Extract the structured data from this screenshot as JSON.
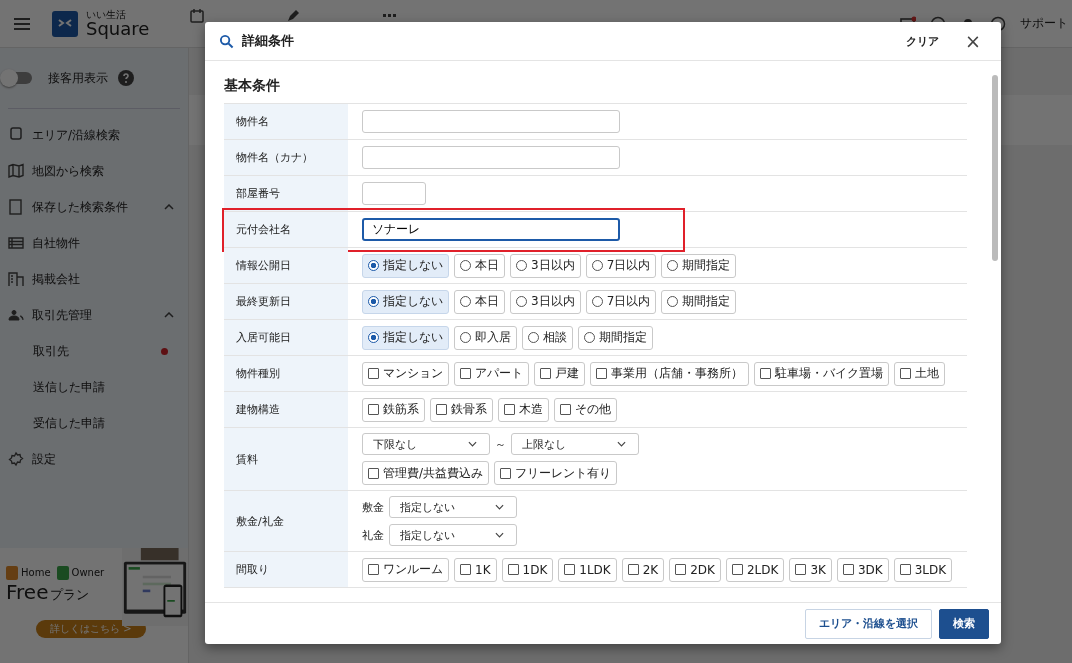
{
  "topbar": {
    "brand_small": "いい生活",
    "brand": "Square",
    "support": "サポート"
  },
  "sidebar": {
    "toggle": {
      "label": "接客用表示",
      "on": false
    },
    "items": [
      {
        "label": "エリア/沿線検索"
      },
      {
        "label": "地図から検索"
      },
      {
        "label": "保存した検索条件",
        "expanded": true
      },
      {
        "label": "自社物件"
      },
      {
        "label": "掲載会社"
      },
      {
        "label": "取引先管理",
        "expanded": true,
        "children": [
          {
            "label": "取引先",
            "notice": true
          },
          {
            "label": "送信した申請",
            "notice": false
          },
          {
            "label": "受信した申請",
            "notice": false
          }
        ]
      },
      {
        "label": "設定"
      }
    ],
    "banner": {
      "home": "Home",
      "owner": "Owner",
      "title_en": "Free",
      "title_ja": "プラン",
      "cta": "詳しくはこちら >"
    }
  },
  "modal": {
    "title": "詳細条件",
    "clear": "クリア",
    "close": "×",
    "section": "基本条件",
    "rows": [
      {
        "label": "物件名",
        "kind": "text",
        "value": "",
        "focused": false,
        "highlighted": false
      },
      {
        "label": "物件名（カナ）",
        "kind": "text",
        "value": "",
        "focused": false,
        "highlighted": false
      },
      {
        "label": "部屋番号",
        "kind": "short_text",
        "value": "",
        "focused": false,
        "highlighted": false
      },
      {
        "label": "元付会社名",
        "kind": "text",
        "value": "ソナーレ",
        "focused": true,
        "highlighted": true
      },
      {
        "label": "情報公開日",
        "kind": "radio",
        "options": [
          {
            "label": "指定しない",
            "selected": true
          },
          {
            "label": "本日",
            "selected": false
          },
          {
            "label": "3日以内",
            "selected": false
          },
          {
            "label": "7日以内",
            "selected": false
          },
          {
            "label": "期間指定",
            "selected": false
          }
        ]
      },
      {
        "label": "最終更新日",
        "kind": "radio",
        "options": [
          {
            "label": "指定しない",
            "selected": true
          },
          {
            "label": "本日",
            "selected": false
          },
          {
            "label": "3日以内",
            "selected": false
          },
          {
            "label": "7日以内",
            "selected": false
          },
          {
            "label": "期間指定",
            "selected": false
          }
        ]
      },
      {
        "label": "入居可能日",
        "kind": "radio",
        "options": [
          {
            "label": "指定しない",
            "selected": true
          },
          {
            "label": "即入居",
            "selected": false
          },
          {
            "label": "相談",
            "selected": false
          },
          {
            "label": "期間指定",
            "selected": false
          }
        ]
      },
      {
        "label": "物件種別",
        "kind": "check",
        "options": [
          {
            "label": "マンション",
            "checked": false
          },
          {
            "label": "アパート",
            "checked": false
          },
          {
            "label": "戸建",
            "checked": false
          },
          {
            "label": "事業用（店舗・事務所）",
            "checked": false
          },
          {
            "label": "駐車場・バイク置場",
            "checked": false
          },
          {
            "label": "土地",
            "checked": false
          }
        ]
      },
      {
        "label": "建物構造",
        "kind": "check",
        "options": [
          {
            "label": "鉄筋系",
            "checked": false
          },
          {
            "label": "鉄骨系",
            "checked": false
          },
          {
            "label": "木造",
            "checked": false
          },
          {
            "label": "その他",
            "checked": false
          }
        ]
      },
      {
        "label": "賃料",
        "kind": "range",
        "selects": [
          {
            "value": "下限なし"
          },
          {
            "value": "上限なし"
          }
        ],
        "separator": "～",
        "options": [
          {
            "label": "管理費/共益費込み",
            "checked": false
          },
          {
            "label": "フリーレント有り",
            "checked": false
          }
        ]
      },
      {
        "label": "敷金/礼金",
        "kind": "pairs",
        "selects": [
          {
            "label": "敷金",
            "value": "指定しない"
          },
          {
            "label": "礼金",
            "value": "指定しない"
          }
        ]
      },
      {
        "label": "間取り",
        "kind": "check",
        "options": [
          {
            "label": "ワンルーム",
            "checked": false
          },
          {
            "label": "1K",
            "checked": false
          },
          {
            "label": "1DK",
            "checked": false
          },
          {
            "label": "1LDK",
            "checked": false
          },
          {
            "label": "2K",
            "checked": false
          },
          {
            "label": "2DK",
            "checked": false
          },
          {
            "label": "2LDK",
            "checked": false
          },
          {
            "label": "3K",
            "checked": false
          },
          {
            "label": "3DK",
            "checked": false
          },
          {
            "label": "3LDK",
            "checked": false
          }
        ]
      }
    ],
    "buttons": [
      {
        "label": "エリア・沿線を選択",
        "primary": false
      },
      {
        "label": "検索",
        "primary": true
      }
    ]
  }
}
